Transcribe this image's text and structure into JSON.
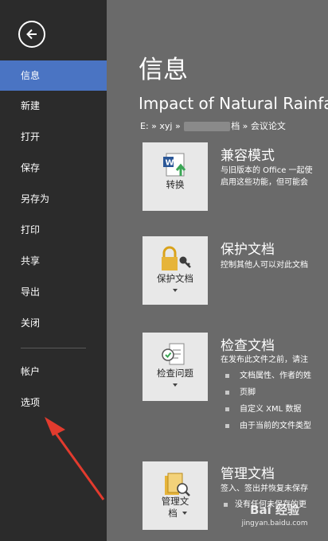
{
  "sidebar": {
    "items": [
      {
        "key": "info",
        "label": "信息"
      },
      {
        "key": "new",
        "label": "新建"
      },
      {
        "key": "open",
        "label": "打开"
      },
      {
        "key": "save",
        "label": "保存"
      },
      {
        "key": "save_as",
        "label": "另存为"
      },
      {
        "key": "print",
        "label": "打印"
      },
      {
        "key": "share",
        "label": "共享"
      },
      {
        "key": "export",
        "label": "导出"
      },
      {
        "key": "close",
        "label": "关闭"
      },
      {
        "key": "account",
        "label": "帐户"
      },
      {
        "key": "options",
        "label": "选项"
      }
    ],
    "active": "info",
    "accent_color": "#4a74c3"
  },
  "main": {
    "title": "信息",
    "doc_title": "Impact of Natural Rainfall",
    "path": {
      "prefix": "E: » xyj » ",
      "suffix": "档 » 会议论文"
    },
    "sections": [
      {
        "title": "兼容模式",
        "button_label": "转换",
        "desc_lines": [
          "与旧版本的 Office 一起使",
          "启用这些功能，但可能会"
        ],
        "icon": "word-convert-icon"
      },
      {
        "title": "保护文档",
        "button_label": "保护文档",
        "desc_lines": [
          "控制其他人可以对此文档"
        ],
        "icon": "lock-key-icon"
      },
      {
        "title": "检查文档",
        "button_label": "检查问题",
        "desc_lines": [
          "在发布此文件之前，请注"
        ],
        "bullets": [
          "文档属性、作者的姓",
          "页脚",
          "自定义 XML 数据",
          "由于当前的文件类型"
        ],
        "icon": "inspect-document-icon"
      },
      {
        "title": "管理文档",
        "button_label_lines": [
          "管理文",
          "档"
        ],
        "desc_lines": [
          "签入、签出并恢复未保存"
        ],
        "bullet_partial": "没有任何未保存的更",
        "icon": "manage-document-icon"
      }
    ]
  },
  "watermark": {
    "brand": "Bai 经验",
    "url": "jingyan.baidu.com"
  }
}
